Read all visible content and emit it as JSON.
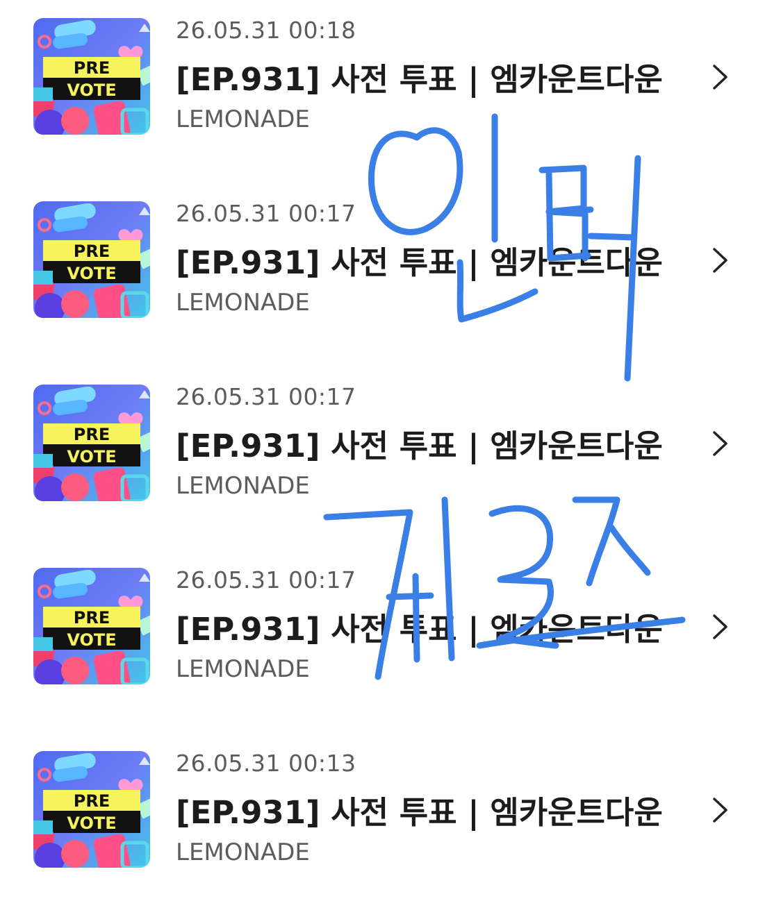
{
  "items": [
    {
      "timestamp": "26.05.31 00:18",
      "title": "[EP.931] 사전 투표 | 엠카운트다운",
      "source": "LEMONADE",
      "thumb_text_1": "PRE",
      "thumb_text_2": "VOTE"
    },
    {
      "timestamp": "26.05.31 00:17",
      "title": "[EP.931] 사전 투표 | 엠카운트다운",
      "source": "LEMONADE",
      "thumb_text_1": "PRE",
      "thumb_text_2": "VOTE"
    },
    {
      "timestamp": "26.05.31 00:17",
      "title": "[EP.931] 사전 투표 | 엠카운트다운",
      "source": "LEMONADE",
      "thumb_text_1": "PRE",
      "thumb_text_2": "VOTE"
    },
    {
      "timestamp": "26.05.31 00:17",
      "title": "[EP.931] 사전 투표 | 엠카운트다운",
      "source": "LEMONADE",
      "thumb_text_1": "PRE",
      "thumb_text_2": "VOTE"
    },
    {
      "timestamp": "26.05.31 00:13",
      "title": "[EP.931] 사전 투표 | 엠카운트다운",
      "source": "LEMONADE",
      "thumb_text_1": "PRE",
      "thumb_text_2": "VOTE"
    }
  ],
  "icons": {
    "row_arrow": "chevron-right-icon"
  },
  "colors": {
    "ink_stroke": "#3a7fe6",
    "thumb_background": "#5b6cf2",
    "thumb_label_band": "#f7f35a"
  }
}
